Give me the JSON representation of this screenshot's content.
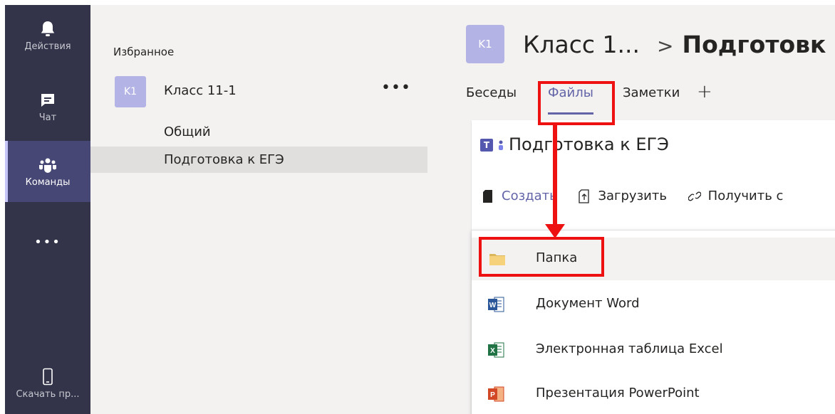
{
  "rail": {
    "items": [
      {
        "label": "Действия",
        "icon": "bell-icon"
      },
      {
        "label": "Чат",
        "icon": "chat-icon"
      },
      {
        "label": "Команды",
        "icon": "teams-icon"
      },
      {
        "label": "•••",
        "icon": "more-icon"
      },
      {
        "label": "Скачать пр...",
        "icon": "mobile-icon"
      }
    ]
  },
  "panel": {
    "favorites_label": "Избранное",
    "team": {
      "avatar": "K1",
      "name": "Класс 11-1",
      "more": "•••"
    },
    "channels": [
      "Общий",
      "Подготовка к ЕГЭ"
    ]
  },
  "header": {
    "avatar": "K1",
    "team": "Класс 1...",
    "separator": ">",
    "channel": "Подготовк"
  },
  "tabs": [
    "Беседы",
    "Файлы",
    "Заметки",
    "+"
  ],
  "files": {
    "title": "Подготовка к ЕГЭ",
    "toolbar": {
      "create": "Создать",
      "upload": "Загрузить",
      "link": "Получить с"
    }
  },
  "menu": {
    "items": [
      {
        "label": "Папка",
        "icon": "folder-icon"
      },
      {
        "label": "Документ Word",
        "icon": "word-icon"
      },
      {
        "label": "Электронная таблица Excel",
        "icon": "excel-icon"
      },
      {
        "label": "Презентация PowerPoint",
        "icon": "powerpoint-icon"
      }
    ]
  },
  "colors": {
    "rail": "#33344a",
    "rail_active": "#464775",
    "accent": "#6264a7",
    "annotation": "#ee1111"
  }
}
